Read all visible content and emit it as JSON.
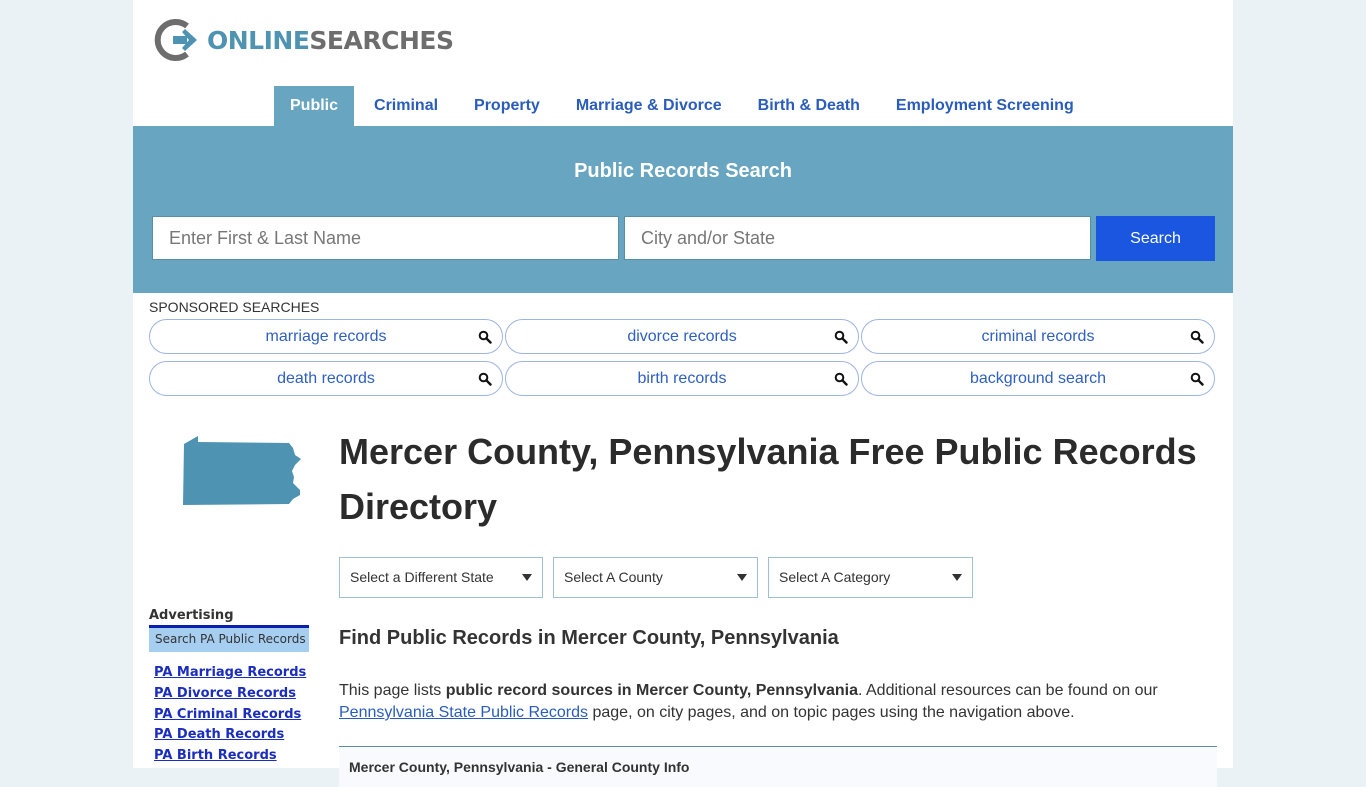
{
  "logo": {
    "part1": "ONLINE",
    "part2": "SEARCHES"
  },
  "nav": {
    "items": [
      {
        "label": "Public",
        "active": true
      },
      {
        "label": "Criminal"
      },
      {
        "label": "Property"
      },
      {
        "label": "Marriage & Divorce"
      },
      {
        "label": "Birth & Death"
      },
      {
        "label": "Employment Screening"
      }
    ]
  },
  "search": {
    "title": "Public Records Search",
    "name_placeholder": "Enter First & Last Name",
    "name_value": "",
    "city_placeholder": "City and/or State",
    "city_value": "",
    "button_label": "Search"
  },
  "sponsored": {
    "label": "SPONSORED SEARCHES",
    "items": [
      {
        "label": "marriage records",
        "icon": "search-icon"
      },
      {
        "label": "divorce records",
        "icon": "search-icon"
      },
      {
        "label": "criminal records",
        "icon": "search-icon"
      },
      {
        "label": "death records",
        "icon": "search-icon"
      },
      {
        "label": "birth records",
        "icon": "search-icon"
      },
      {
        "label": "background search",
        "icon": "search-icon"
      }
    ]
  },
  "state_map": {
    "state": "Pennsylvania",
    "color": "#4f93b3"
  },
  "main": {
    "title": "Mercer County, Pennsylvania Free Public Records Directory",
    "selects": {
      "state": "Select a Different State",
      "county": "Select A County",
      "category": "Select A Category"
    },
    "section_heading": "Find Public Records in Mercer County, Pennsylvania",
    "intro": {
      "prefix": "This page lists ",
      "bold": "public record sources in Mercer County, Pennsylvania",
      "middle": ". Additional resources can be found on our ",
      "link": "Pennsylvania State Public Records",
      "suffix": " page, on city pages, and on topic pages using the navigation above."
    },
    "info_box_title": "Mercer County, Pennsylvania - General County Info"
  },
  "sidebar": {
    "advertising_label": "Advertising",
    "box_title": "Search PA Public Records",
    "links": [
      "PA Marriage Records",
      "PA Divorce Records",
      "PA Criminal Records",
      "PA Death Records",
      "PA Birth Records"
    ]
  },
  "colors": {
    "accent": "#68a5c0",
    "search_button": "#1a56e0",
    "link": "#2a5dbb",
    "background": "#eaf2f6"
  }
}
